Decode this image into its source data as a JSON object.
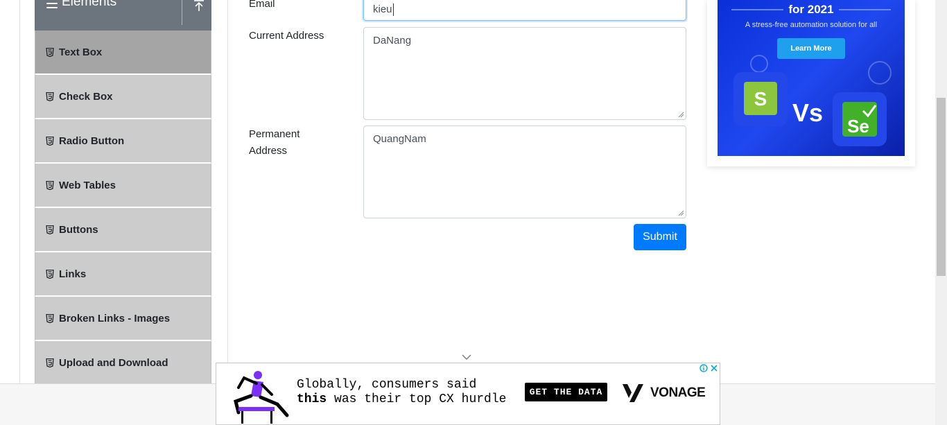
{
  "sidebar": {
    "group_title": "Elements",
    "items": [
      {
        "label": "Text Box",
        "active": true
      },
      {
        "label": "Check Box"
      },
      {
        "label": "Radio Button"
      },
      {
        "label": "Web Tables"
      },
      {
        "label": "Buttons"
      },
      {
        "label": "Links"
      },
      {
        "label": "Broken Links - Images"
      },
      {
        "label": "Upload and Download"
      }
    ]
  },
  "form": {
    "email_label": "Email",
    "email_value": "kieu",
    "current_address_label": "Current Address",
    "current_address_value": "DaNang",
    "permanent_address_label_1": "Permanent",
    "permanent_address_label_2": "Address",
    "permanent_address_value": "QuangNam",
    "submit_label": "Submit"
  },
  "side_ad": {
    "year_text": "for 2021",
    "subtitle": "A stress-free automation solution for all",
    "button_label": "Learn More",
    "vs_text": "Vs",
    "se_text": "Se",
    "s_text": "S"
  },
  "bottom_ad": {
    "line1": "Globally, consumers said",
    "line2_bold": "this",
    "line2_rest": " was their top CX hurdle",
    "cta": "GET THE DATA",
    "brand": "VONAGE"
  },
  "colors": {
    "primary": "#007bff",
    "sidebar_header": "#6c757d",
    "menu_item": "#cccccc",
    "menu_item_active": "#a5a5a5",
    "ad_blue": "#1f48f0"
  }
}
